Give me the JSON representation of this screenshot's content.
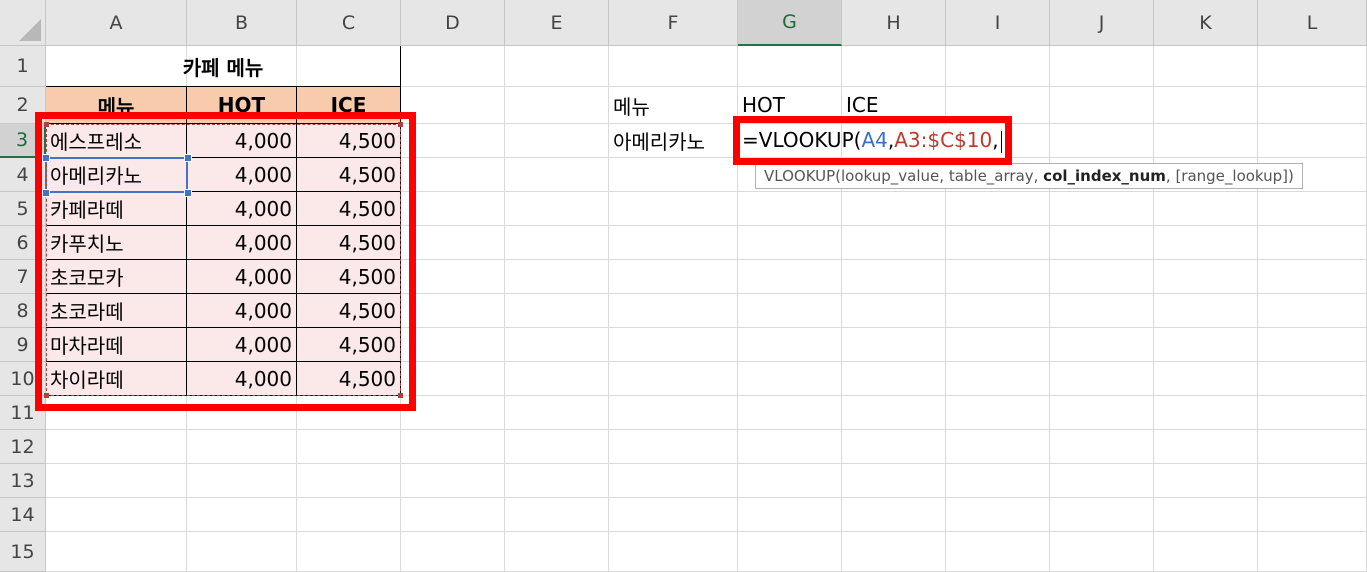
{
  "columns": [
    "A",
    "B",
    "C",
    "D",
    "E",
    "F",
    "G",
    "H",
    "I",
    "J",
    "K",
    "L"
  ],
  "rows": [
    "1",
    "2",
    "3",
    "4",
    "5",
    "6",
    "7",
    "8",
    "9",
    "10",
    "11",
    "12",
    "13",
    "14",
    "15"
  ],
  "selected_column": "G",
  "selected_row": "3",
  "menu_table": {
    "title": "카페 메뉴",
    "headers": [
      "메뉴",
      "HOT",
      "ICE"
    ],
    "items": [
      {
        "name": "에스프레소",
        "hot": "4,000",
        "ice": "4,500"
      },
      {
        "name": "아메리카노",
        "hot": "4,000",
        "ice": "4,500"
      },
      {
        "name": "카페라떼",
        "hot": "4,000",
        "ice": "4,500"
      },
      {
        "name": "카푸치노",
        "hot": "4,000",
        "ice": "4,500"
      },
      {
        "name": "초코모카",
        "hot": "4,000",
        "ice": "4,500"
      },
      {
        "name": "초코라떼",
        "hot": "4,000",
        "ice": "4,500"
      },
      {
        "name": "마차라떼",
        "hot": "4,000",
        "ice": "4,500"
      },
      {
        "name": "차이라떼",
        "hot": "4,000",
        "ice": "4,500"
      }
    ]
  },
  "lookup": {
    "header_menu": "메뉴",
    "header_hot": "HOT",
    "header_ice": "ICE",
    "menu_value": "아메리카노",
    "formula_parts": {
      "prefix": "=VLOOKUP(",
      "arg1": "A4",
      "sep1": ",",
      "arg2": "A3:$C$10",
      "sep2": ","
    }
  },
  "tooltip": {
    "func": "VLOOKUP(",
    "arg1": "lookup_value, ",
    "arg2": "table_array, ",
    "arg3_bold": "col_index_num",
    "arg4": ", [range_lookup])"
  },
  "colors": {
    "header_fill": "#f8cbad",
    "body_fill": "#fbe9e9",
    "highlight_box": "#ff0000",
    "selection": "#217346",
    "ref_blue": "#3a6fc8",
    "ref_red": "#c0392b"
  }
}
